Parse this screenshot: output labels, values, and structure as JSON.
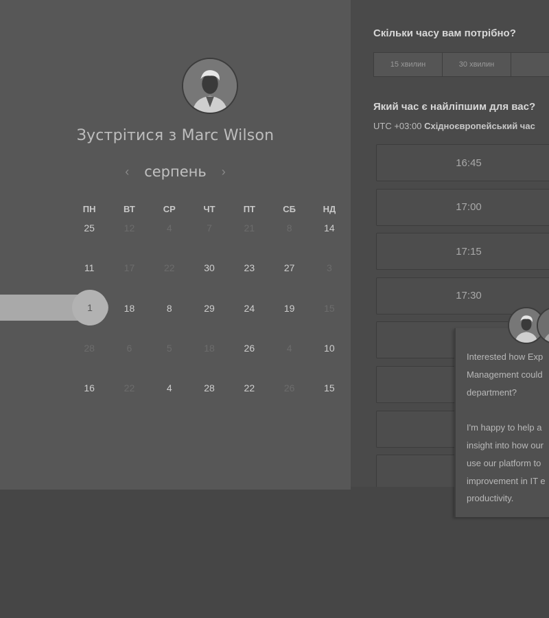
{
  "meeting": {
    "title": "Зустрітися з Marc Wilson",
    "month": "серпень",
    "prev_icon": "chevron-left-icon",
    "next_icon": "chevron-right-icon"
  },
  "calendar": {
    "weekdays": [
      "ПН",
      "ВТ",
      "СР",
      "ЧТ",
      "ПТ",
      "СБ",
      "НД"
    ],
    "weeks": [
      [
        "25",
        "12",
        "4",
        "7",
        "21",
        "8",
        "14"
      ],
      [
        "11",
        "17",
        "22",
        "30",
        "23",
        "27",
        "3"
      ],
      [
        "1",
        "18",
        "8",
        "29",
        "24",
        "19",
        "15"
      ],
      [
        "28",
        "6",
        "5",
        "18",
        "26",
        "4",
        "10"
      ],
      [
        "16",
        "22",
        "4",
        "28",
        "22",
        "26",
        "15"
      ]
    ],
    "dim": [
      [
        false,
        true,
        true,
        true,
        true,
        true,
        false
      ],
      [
        false,
        true,
        true,
        false,
        false,
        false,
        true
      ],
      [
        false,
        false,
        false,
        false,
        false,
        false,
        true
      ],
      [
        true,
        true,
        true,
        true,
        false,
        true,
        false
      ],
      [
        false,
        true,
        false,
        false,
        false,
        true,
        false
      ]
    ],
    "selected": "1"
  },
  "booking": {
    "duration_question": "Скільки часу вам потрібно?",
    "durations": [
      "15 хвилин",
      "30 хвилин",
      ""
    ],
    "time_question": "Який час є найліпшим для вас?",
    "tz_offset": "UTC +03:00",
    "tz_name": "Східноєвропейський час",
    "slots": [
      "16:45",
      "17:00",
      "17:15",
      "17:30",
      "",
      "",
      "",
      ""
    ]
  },
  "chat": {
    "message": "Interested how Exp\nManagement could\ndepartment?\n\nI'm happy to help a\ninsight into how our\nuse our platform to\nimprovement in IT e\nproductivity."
  }
}
